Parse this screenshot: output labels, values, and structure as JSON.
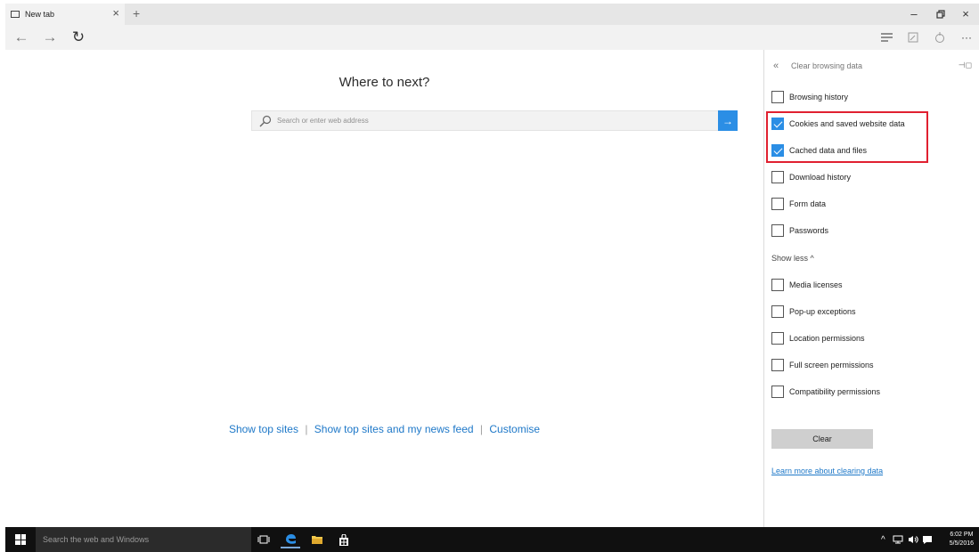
{
  "browser": {
    "tab_title": "New tab",
    "tab_close": "×",
    "new_tab": "+",
    "window_controls": {
      "minimize": "–",
      "maximize": "▫",
      "close": "×"
    },
    "nav": {
      "back": "←",
      "forward": "→",
      "refresh": "↻"
    },
    "tools": {
      "more": "···"
    }
  },
  "main": {
    "heading": "Where to next?",
    "search": {
      "placeholder": "Search or enter web address",
      "go_arrow": "→"
    },
    "links": {
      "top_sites": "Show top sites",
      "separator": "|",
      "top_sites_feed": "Show top sites and my news feed",
      "customise": "Customise"
    }
  },
  "panel": {
    "back": "«",
    "title": "Clear browsing data",
    "pin": "⊣◻",
    "items": [
      {
        "label": "Browsing history",
        "checked": false
      },
      {
        "label": "Cookies and saved website data",
        "checked": true
      },
      {
        "label": "Cached data and files",
        "checked": true
      },
      {
        "label": "Download history",
        "checked": false
      },
      {
        "label": "Form data",
        "checked": false
      },
      {
        "label": "Passwords",
        "checked": false
      }
    ],
    "show_less": "Show less ^",
    "more_items": [
      {
        "label": "Media licenses",
        "checked": false
      },
      {
        "label": "Pop-up exceptions",
        "checked": false
      },
      {
        "label": "Location permissions",
        "checked": false
      },
      {
        "label": "Full screen permissions",
        "checked": false
      },
      {
        "label": "Compatibility permissions",
        "checked": false
      }
    ],
    "clear_button": "Clear",
    "learn_more": "Learn more about clearing data",
    "colors": {
      "accent": "#2b8ee5",
      "highlight": "#e02030"
    }
  },
  "taskbar": {
    "search_text": "Search the web and Windows",
    "tray_arrow": "^",
    "time": "6:02 PM",
    "date": "5/5/2016"
  }
}
